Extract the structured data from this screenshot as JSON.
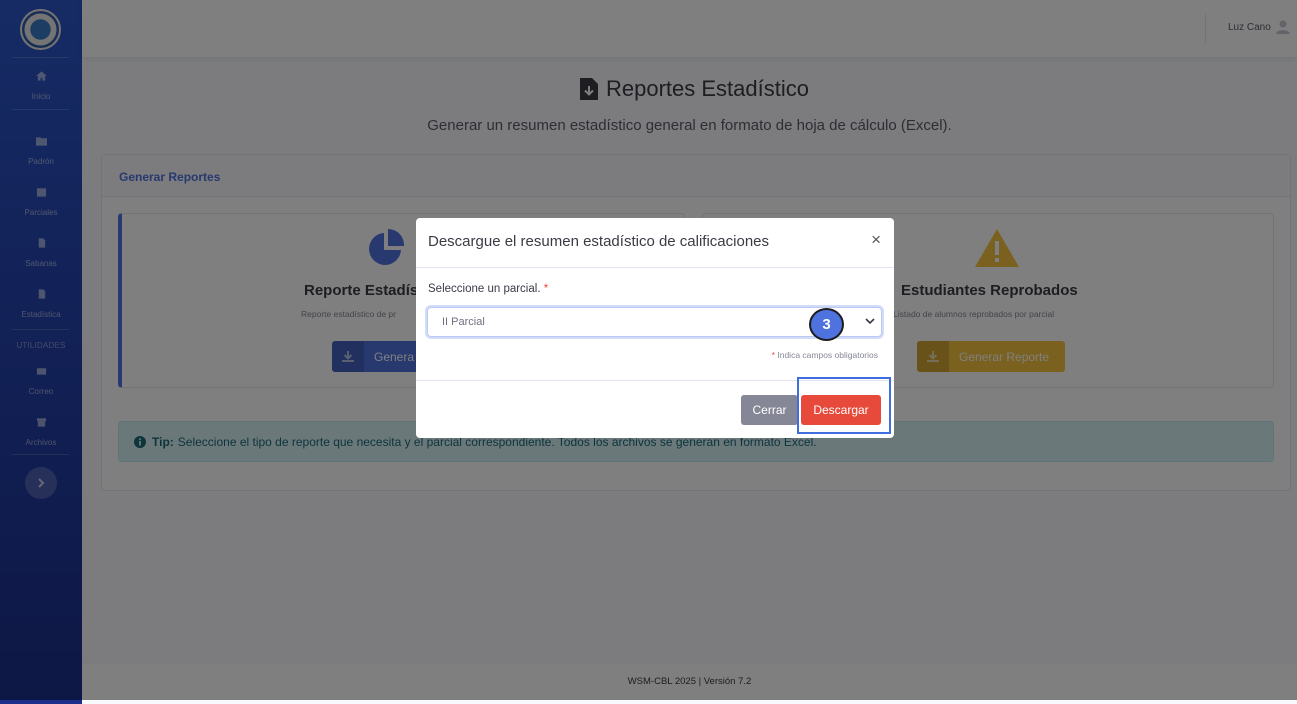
{
  "sidebar": {
    "items": [
      {
        "label": "Inicio",
        "icon": "home-icon"
      },
      {
        "label": "Padrón",
        "icon": "folder-icon"
      },
      {
        "label": "Parciales",
        "icon": "calendar-icon"
      },
      {
        "label": "Sabanas",
        "icon": "file-icon"
      },
      {
        "label": "Estadística",
        "icon": "file-icon"
      },
      {
        "label": "Correo",
        "icon": "envelope-icon"
      },
      {
        "label": "Archivos",
        "icon": "archive-icon"
      }
    ],
    "heading": "UTILIDADES"
  },
  "topbar": {
    "user_name": "Luz Cano"
  },
  "page": {
    "title": "Reportes Estadístico",
    "subtitle": "Generar un resumen estadístico general en formato de hoja de cálculo (Excel)."
  },
  "card": {
    "header": "Generar Reportes",
    "left": {
      "title": "Reporte Estadís",
      "desc": "Reporte estadístico de pr",
      "button": "Genera"
    },
    "right": {
      "title": "Estudiantes Reprobados",
      "desc": "Listado de alumnos reprobados por parcial",
      "button": "Generar Reporte"
    },
    "tip_label": "Tip:",
    "tip_text": "Seleccione el tipo de reporte que necesita y el parcial correspondiente. Todos los archivos se generan en formato Excel."
  },
  "footer": {
    "text": "WSM-CBL 2025 | Versión 7.2"
  },
  "modal": {
    "title": "Descargue el resumen estadístico de calificaciones",
    "close": "×",
    "field_label": "Seleccione un parcial.",
    "required_mark": "*",
    "select_value": "II Parcial",
    "required_note": "Indica campos obligatorios",
    "cancel": "Cerrar",
    "submit": "Descargar"
  },
  "annotation": {
    "step": "3"
  },
  "colors": {
    "primary": "#4e73df",
    "danger": "#e74a3b",
    "warning": "#f6c23e",
    "secondary": "#858796"
  }
}
